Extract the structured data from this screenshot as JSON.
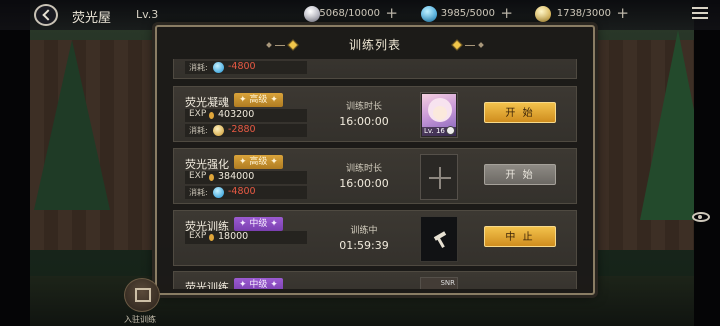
{
  "header": {
    "title": "荧光屋",
    "level": "Lv.3",
    "resources": [
      {
        "icon": "silver-orb-icon",
        "value": "5068/10000",
        "color": "#c9c9d4"
      },
      {
        "icon": "blue-orb-icon",
        "value": "3985/5000",
        "color": "#3ab6f0"
      },
      {
        "icon": "gold-orb-icon",
        "value": "1738/3000",
        "color": "#e8c86a"
      }
    ]
  },
  "panel": {
    "title": "训练列表"
  },
  "cost_label": "消耗:",
  "exp_label": "EXP",
  "training_list": [
    {
      "name": "",
      "cost": "-4800",
      "cost_icon": "blue-coin-icon"
    },
    {
      "name": "荧光凝魂",
      "grade": "✦ 高级 ✦",
      "exp": "403200",
      "cost": "-2880",
      "cost_icon": "gold-coin-icon",
      "status_label": "训练时长",
      "status_value": "16:00:00",
      "slot": "character",
      "character_level": "Lv. 16",
      "button": "开 始"
    },
    {
      "name": "荧光强化",
      "grade": "✦ 高级 ✦",
      "exp": "384000",
      "cost": "-4800",
      "cost_icon": "blue-coin-icon",
      "status_label": "训练时长",
      "status_value": "16:00:00",
      "slot": "empty",
      "button": "开 始"
    },
    {
      "name": "荧光训练",
      "grade": "✦ 中级 ✦",
      "exp": "18000",
      "status_label": "训练中",
      "status_value": "01:59:39",
      "slot": "hammer",
      "button": "中 止"
    },
    {
      "name": "荧光训练",
      "grade": "✦ 中级 ✦",
      "slot_tag": "SNR"
    }
  ],
  "bottom": {
    "enter_label": "入驻训练"
  }
}
